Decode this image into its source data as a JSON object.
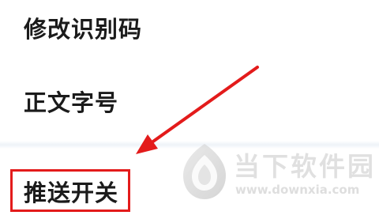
{
  "settings": {
    "items": [
      {
        "label": "修改识别码"
      },
      {
        "label": "正文字号"
      },
      {
        "label": "推送开关"
      }
    ]
  },
  "annotation": {
    "color": "#e31b1b"
  },
  "watermark": {
    "name": "当下软件园",
    "url": "www.downxia.com"
  }
}
